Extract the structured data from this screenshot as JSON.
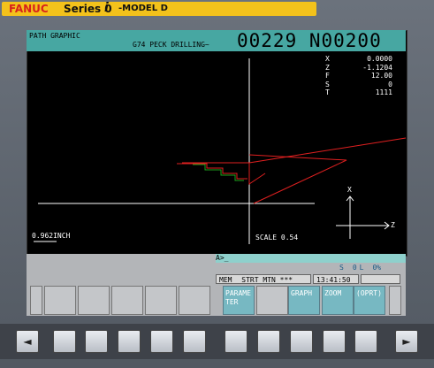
{
  "brand": {
    "maker": "FANUC",
    "series": "Series 0",
    "i": "i",
    "model": "-MODEL D"
  },
  "header": {
    "mode": "PATH GRAPHIC",
    "program": "G74 PECK DRILLING~",
    "number": "00229 N00200"
  },
  "coords": [
    {
      "axis": "X",
      "value": "0.0000"
    },
    {
      "axis": "Z",
      "value": "-1.1204"
    },
    {
      "axis": "F",
      "value": "12.00"
    },
    {
      "axis": "S",
      "value": "0"
    },
    {
      "axis": "T",
      "value": "1111"
    }
  ],
  "scale": {
    "left": "0.962INCH",
    "right": "SCALE 0.54"
  },
  "axes": {
    "x": "X",
    "z": "Z"
  },
  "cmdline": "A>_",
  "status": {
    "s_label": "S",
    "s_value": "0",
    "l_label": "L",
    "l_value": "0%"
  },
  "statusbar": {
    "mode": "MEM",
    "state": "STRT",
    "motion": "MTN",
    "extra": "***",
    "time": "13:41:50"
  },
  "softkeys": [
    {
      "label": ""
    },
    {
      "label": ""
    },
    {
      "label": ""
    },
    {
      "label": ""
    },
    {
      "label": ""
    },
    {
      "label": ""
    },
    {
      "label": "PARAME\nTER"
    },
    {
      "label": ""
    },
    {
      "label": "GRAPH"
    },
    {
      "label": "ZOOM"
    },
    {
      "label": "(OPRT)"
    }
  ],
  "hw": {
    "left": "◄",
    "right": "►"
  },
  "colors": {
    "screen_bg": "#000000",
    "header": "#47a7a2",
    "path_red": "#e02020",
    "path_green": "#1da31d"
  }
}
